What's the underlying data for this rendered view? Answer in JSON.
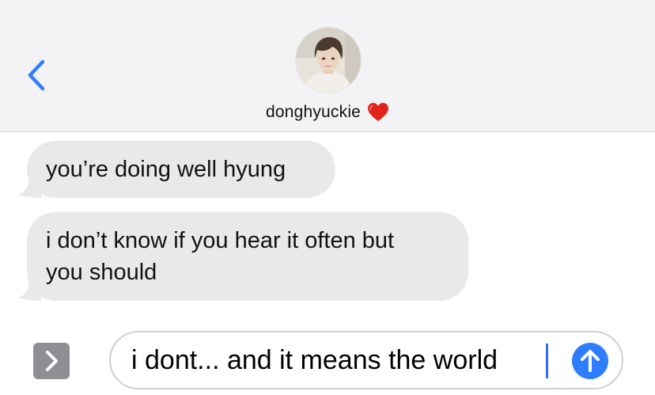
{
  "header": {
    "contact_name": "donghyuckie",
    "heart_icon": "red-heart-emoji",
    "back_icon": "chevron-left-icon",
    "accent": "#2f7dff"
  },
  "messages": [
    {
      "direction": "incoming",
      "lines": [
        "you’re doing well hyung"
      ]
    },
    {
      "direction": "incoming",
      "lines": [
        "i don’t know if you hear it often but",
        "you should"
      ]
    }
  ],
  "composer": {
    "apps_icon": "chevron-right-icon",
    "value": "i dont... and it means the world",
    "send_icon": "arrow-up-icon"
  },
  "colors": {
    "bubble_incoming": "#e9e9eb",
    "header_bg": "#f3f3f5",
    "send_button": "#2f7dff",
    "caret": "#2f6cff"
  }
}
